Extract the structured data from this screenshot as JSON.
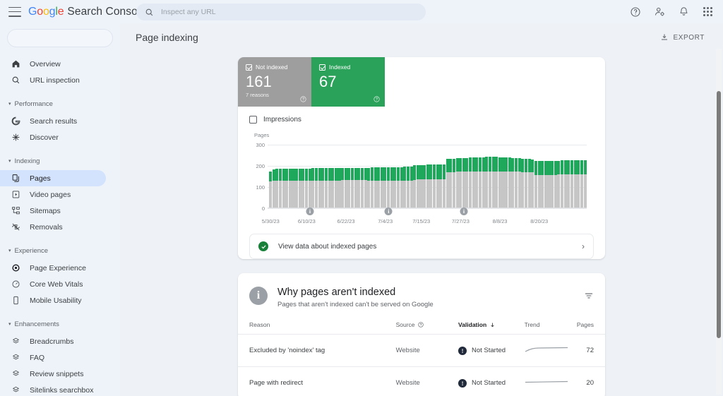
{
  "topbar": {
    "brand_google": "Google",
    "brand_sub": "Search Console",
    "search_placeholder": "Inspect any URL",
    "search_value": "",
    "icons": [
      "help-icon",
      "account-settings-icon",
      "notifications-bell-icon",
      "apps-grid-icon"
    ]
  },
  "sidebar": {
    "property_selector_value": "",
    "items": [
      {
        "label": "Overview",
        "icon": "home-icon",
        "type": "item",
        "active": false
      },
      {
        "label": "URL inspection",
        "icon": "search-icon",
        "type": "item",
        "active": false
      },
      {
        "label": "Performance",
        "icon": "caret-down-icon",
        "type": "group"
      },
      {
        "label": "Search results",
        "icon": "google-g-icon",
        "type": "item",
        "active": false
      },
      {
        "label": "Discover",
        "icon": "discover-sparkle-icon",
        "type": "item",
        "active": false
      },
      {
        "label": "Indexing",
        "icon": "caret-down-icon",
        "type": "group"
      },
      {
        "label": "Pages",
        "icon": "pages-copy-icon",
        "type": "item",
        "active": true
      },
      {
        "label": "Video pages",
        "icon": "video-page-icon",
        "type": "item",
        "active": false
      },
      {
        "label": "Sitemaps",
        "icon": "sitemap-icon",
        "type": "item",
        "active": false
      },
      {
        "label": "Removals",
        "icon": "hidden-eye-icon",
        "type": "item",
        "active": false
      },
      {
        "label": "Experience",
        "icon": "caret-down-icon",
        "type": "group"
      },
      {
        "label": "Page Experience",
        "icon": "page-experience-icon",
        "type": "item",
        "active": false
      },
      {
        "label": "Core Web Vitals",
        "icon": "speedometer-icon",
        "type": "item",
        "active": false
      },
      {
        "label": "Mobile Usability",
        "icon": "mobile-phone-icon",
        "type": "item",
        "active": false
      },
      {
        "label": "Enhancements",
        "icon": "caret-down-icon",
        "type": "group"
      },
      {
        "label": "Breadcrumbs",
        "icon": "rich-result-icon",
        "type": "item",
        "active": false
      },
      {
        "label": "FAQ",
        "icon": "rich-result-icon",
        "type": "item",
        "active": false
      },
      {
        "label": "Review snippets",
        "icon": "rich-result-icon",
        "type": "item",
        "active": false
      },
      {
        "label": "Sitelinks searchbox",
        "icon": "rich-result-icon",
        "type": "item",
        "active": false
      }
    ]
  },
  "page": {
    "title": "Page indexing",
    "export_label": "EXPORT",
    "export_icon": "download-icon"
  },
  "status_tiles": [
    {
      "label": "Not indexed",
      "value": "161",
      "sub": "7 reasons",
      "color": "#9e9e9e",
      "checkbox_icon": "checked-box-icon",
      "help_icon": "help-circle-icon"
    },
    {
      "label": "Indexed",
      "value": "67",
      "sub": "",
      "color": "#2aa25a",
      "checkbox_icon": "checked-box-icon",
      "help_icon": "help-circle-icon"
    }
  ],
  "impressions_toggle": {
    "label": "Impressions",
    "checked": false,
    "icon": "checkbox-unchecked-icon"
  },
  "chart_data": {
    "type": "bar",
    "title": "",
    "ylabel": "Pages",
    "xlabel": "",
    "ylim": [
      0,
      300
    ],
    "yticks": [
      0,
      100,
      200,
      300
    ],
    "grid": true,
    "stacked": true,
    "legend_position": "top-tiles",
    "tick_labels": [
      "5/30/23",
      "6/10/23",
      "6/22/23",
      "7/4/23",
      "7/15/23",
      "7/27/23",
      "8/8/23",
      "8/20/23"
    ],
    "tick_indices": [
      0,
      11,
      23,
      35,
      46,
      58,
      70,
      82
    ],
    "annotations": [
      {
        "index": 12,
        "label": "i",
        "icon": "info-marker-icon"
      },
      {
        "index": 36,
        "label": "i",
        "icon": "info-marker-icon"
      },
      {
        "index": 59,
        "label": "i",
        "icon": "info-marker-icon"
      }
    ],
    "series": [
      {
        "name": "Not indexed",
        "color": "#c6c6c6",
        "values": [
          127,
          130,
          130,
          130,
          130,
          130,
          130,
          130,
          130,
          130,
          131,
          131,
          131,
          131,
          131,
          131,
          131,
          131,
          131,
          131,
          131,
          131,
          132,
          132,
          132,
          132,
          132,
          132,
          132,
          132,
          131,
          131,
          131,
          131,
          131,
          131,
          131,
          130,
          130,
          130,
          130,
          131,
          131,
          131,
          135,
          136,
          136,
          136,
          137,
          137,
          137,
          137,
          138,
          138,
          170,
          171,
          171,
          172,
          172,
          173,
          173,
          173,
          174,
          174,
          174,
          174,
          175,
          175,
          175,
          175,
          174,
          174,
          174,
          173,
          173,
          172,
          172,
          171,
          170,
          170,
          169,
          158,
          158,
          158,
          158,
          158,
          158,
          158,
          159,
          159,
          159,
          159,
          159,
          159,
          159,
          159,
          159
        ]
      },
      {
        "name": "Indexed",
        "color": "#1ea85c",
        "values": [
          48,
          55,
          56,
          56,
          57,
          57,
          57,
          57,
          57,
          57,
          57,
          57,
          57,
          58,
          58,
          58,
          58,
          58,
          58,
          58,
          58,
          58,
          58,
          58,
          58,
          58,
          58,
          58,
          58,
          58,
          60,
          61,
          61,
          61,
          62,
          62,
          63,
          64,
          64,
          65,
          65,
          65,
          66,
          66,
          67,
          68,
          68,
          69,
          69,
          70,
          70,
          70,
          70,
          70,
          63,
          64,
          64,
          64,
          65,
          65,
          65,
          66,
          66,
          66,
          66,
          67,
          67,
          67,
          67,
          67,
          67,
          66,
          66,
          66,
          65,
          65,
          64,
          64,
          63,
          63,
          62,
          65,
          65,
          66,
          66,
          66,
          66,
          66,
          66,
          67,
          67,
          67,
          67,
          67,
          67,
          67,
          67
        ]
      }
    ]
  },
  "view_data_row": {
    "label": "View data about indexed pages",
    "status_icon": "check-circle-icon",
    "chevron_icon": "chevron-right-icon"
  },
  "why_section": {
    "icon": "info-circle-icon",
    "title": "Why pages aren't indexed",
    "subtitle": "Pages that aren't indexed can't be served on Google",
    "filter_icon": "filter-icon",
    "columns": [
      {
        "label": "Reason",
        "align": "left",
        "icon": null,
        "sorted": false
      },
      {
        "label": "Source",
        "align": "left",
        "icon": "help-circle-icon",
        "sorted": false
      },
      {
        "label": "Validation",
        "align": "left",
        "icon": "sort-arrow-down-icon",
        "sorted": true
      },
      {
        "label": "Trend",
        "align": "left",
        "icon": null,
        "sorted": false
      },
      {
        "label": "Pages",
        "align": "right",
        "icon": null,
        "sorted": false
      }
    ],
    "rows": [
      {
        "reason": "Excluded by 'noindex' tag",
        "source": "Website",
        "validation": "Not Started",
        "validation_icon": "exclamation-circle-icon",
        "trend_icon": "sparkline-icon",
        "pages": "72"
      },
      {
        "reason": "Page with redirect",
        "source": "Website",
        "validation": "Not Started",
        "validation_icon": "exclamation-circle-icon",
        "trend_icon": "sparkline-icon",
        "pages": "20"
      }
    ]
  },
  "scrollbar": {
    "name": "main-scrollbar"
  }
}
